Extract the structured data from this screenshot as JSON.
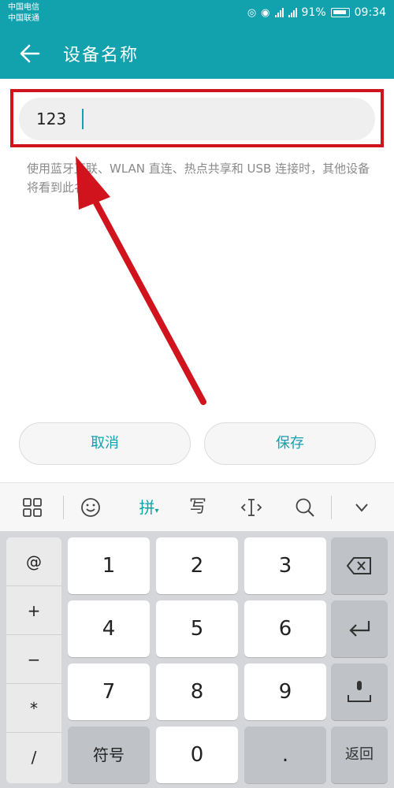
{
  "status_bar": {
    "carrier_1": "中国电信",
    "carrier_2": "中国联通",
    "network_1": "4G 2G",
    "network_2": "4G",
    "battery": "91%",
    "time": "09:34"
  },
  "app_bar": {
    "back_icon": "arrow-left",
    "title": "设备名称"
  },
  "name_input": {
    "value": "123"
  },
  "hint": "使用蓝牙互联、WLAN 直连、热点共享和 USB 连接时，其他设备将看到此名称。",
  "buttons": {
    "cancel": "取消",
    "save": "保存"
  },
  "keyboard_toolbar": {
    "menu_icon": "grid-icon",
    "emoji_icon": "smiley-icon",
    "pinyin": "拼",
    "handwrite": "写",
    "cursor_icon": "text-cursor-icon",
    "search_icon": "search-icon",
    "collapse_icon": "chevron-down-icon"
  },
  "keyboard": {
    "symbols": [
      "@",
      "+",
      "−",
      "*",
      "/"
    ],
    "digits_row1": [
      "1",
      "2",
      "3"
    ],
    "digits_row2": [
      "4",
      "5",
      "6"
    ],
    "digits_row3": [
      "7",
      "8",
      "9"
    ],
    "bottom_row": [
      "符号",
      "0",
      "."
    ],
    "return_label": "返回"
  },
  "colors": {
    "accent": "#12a2ae",
    "annotation_red": "#d0131d"
  }
}
